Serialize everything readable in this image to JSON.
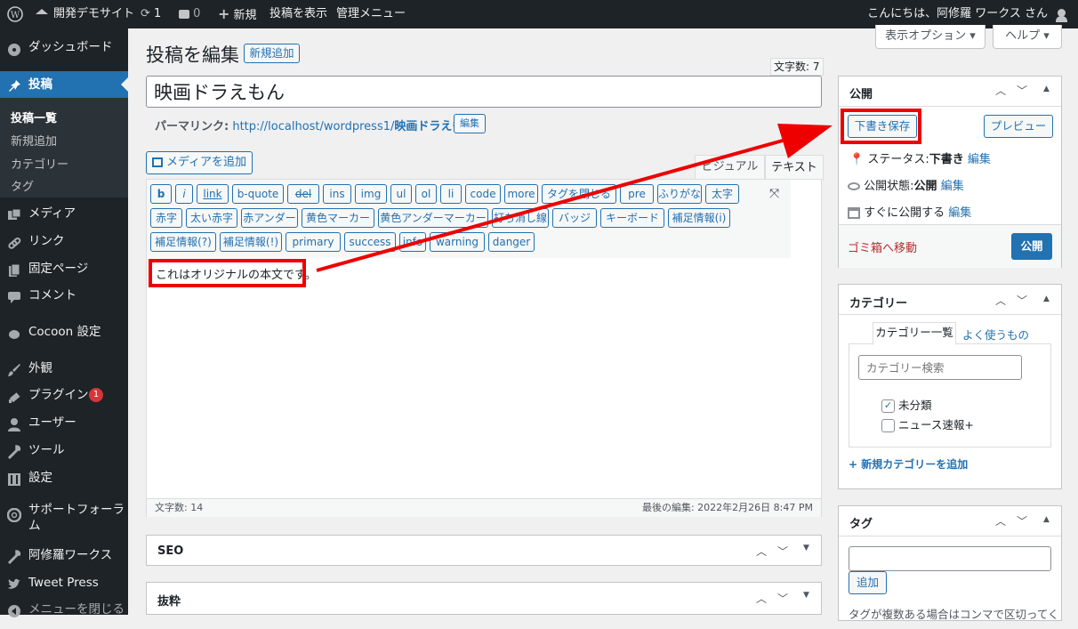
{
  "adminbar": {
    "site_name": "開発デモサイト",
    "updates_count": "1",
    "comments_count": "0",
    "new_label": "新規",
    "view_post": "投稿を表示",
    "admin_menu": "管理メニュー",
    "greeting": "こんにちは、阿修羅 ワークス さん"
  },
  "sidebar": {
    "dashboard": "ダッシュボード",
    "posts": "投稿",
    "sub_all": "投稿一覧",
    "sub_new": "新規追加",
    "sub_cat": "カテゴリー",
    "sub_tag": "タグ",
    "media": "メディア",
    "links": "リンク",
    "pages": "固定ページ",
    "comments": "コメント",
    "cocoon": "Cocoon 設定",
    "appearance": "外観",
    "plugins": "プラグイン",
    "plugins_badge": "1",
    "users": "ユーザー",
    "tools": "ツール",
    "settings": "設定",
    "support_1": "サポートフォーラ",
    "support_2": "ム",
    "ashura": "阿修羅ワークス",
    "tweet": "Tweet Press",
    "collapse": "メニューを閉じる"
  },
  "header": {
    "screen_options": "表示オプション ▾",
    "help": "ヘルプ ▾",
    "page_title": "投稿を編集",
    "add_new": "新規追加",
    "title_count": "文字数: 7"
  },
  "post": {
    "title": "映画ドラえもん",
    "permalink_label": "パーマリンク:",
    "permalink_base": "http://localhost/wordpress1/",
    "permalink_slug": "映画ドラえもん",
    "permalink_tail": "/",
    "permalink_edit": "編集"
  },
  "editor": {
    "add_media": "メディアを追加",
    "tab_visual": "ビジュアル",
    "tab_text": "テキスト",
    "row1": [
      "b",
      "i",
      "link",
      "b-quote",
      "del",
      "ins",
      "img",
      "ul",
      "ol",
      "li",
      "code",
      "more",
      "タグを閉じる",
      "pre",
      "ふりがな",
      "太字"
    ],
    "row2": [
      "赤字",
      "太い赤字",
      "赤アンダー",
      "黄色マーカー",
      "黄色アンダーマーカー",
      "打ち消し線",
      "バッジ",
      "キーボード",
      "補足情報(i)"
    ],
    "row3": [
      "補足情報(?)",
      "補足情報(!)",
      "primary",
      "success",
      "info",
      "warning",
      "danger"
    ],
    "body": "これはオリジナルの本文です。",
    "word_count": "文字数: 14",
    "last_edit": "最後の編集: 2022年2月26日 8:47 PM"
  },
  "metaboxes": {
    "seo": "SEO",
    "excerpt": "抜粋"
  },
  "publish": {
    "title": "公開",
    "save_draft": "下書き保存",
    "preview": "プレビュー",
    "status_label": "ステータス:",
    "status_value": "下書き",
    "visibility_label": "公開状態:",
    "visibility_value": "公開",
    "schedule": "すぐに公開する",
    "edit": "編集",
    "trash": "ゴミ箱へ移動",
    "publish": "公開"
  },
  "categories": {
    "title": "カテゴリー",
    "tab_all": "カテゴリー一覧",
    "tab_popular": "よく使うもの",
    "search_placeholder": "カテゴリー検索",
    "items": [
      "未分類",
      "ニュース速報+"
    ],
    "add_new": "+ 新規カテゴリーを追加"
  },
  "tags": {
    "title": "タグ",
    "add": "追加",
    "hint": "タグが複数ある場合はコンマで区切ってく"
  },
  "colors": {
    "accent": "#2271b1",
    "sidebar_bg": "#1d2327",
    "active_menu": "#2271b1",
    "highlight_red": "#ee0000",
    "trash_red": "#b32d2e"
  }
}
